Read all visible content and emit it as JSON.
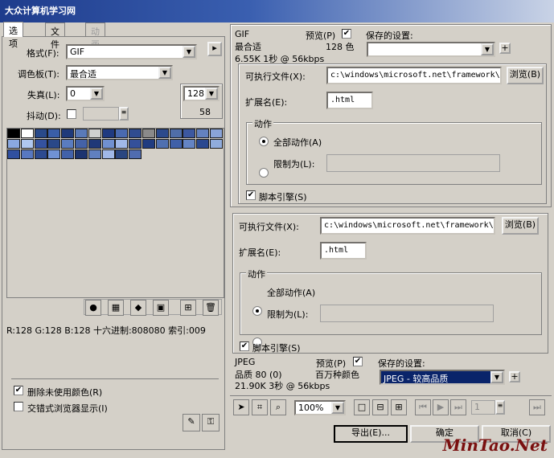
{
  "banner": {
    "logo": "大众计算机学习网"
  },
  "tabs": [
    "选项",
    "文件",
    "动画"
  ],
  "options": {
    "format_label": "格式(F):",
    "format_value": "GIF",
    "palette_label": "调色板(T):",
    "palette_value": "最合适",
    "loss_label": "失真(L):",
    "loss_value": "0",
    "dither_label": "抖动(D):",
    "colors_value": "128",
    "colors_count": "58"
  },
  "palette_info": "R:128 G:128 B:128 十六进制:808080 索引:009",
  "checks": {
    "remove_unused": "删除未使用颜色(R)",
    "interlaced": "交错式浏览器显示(I)"
  },
  "palette_colors": [
    "#000000",
    "#ffffff",
    "#2a4a8a",
    "#3a5ea8",
    "#1f3a7a",
    "#5a7ab8",
    "#d0d0d0",
    "#203a80",
    "#4a6ab0",
    "#304c90",
    "#8a8a8a",
    "#2c4a8c",
    "#506ea8",
    "#3c58a0",
    "#6482c0",
    "#8aa4d8",
    "#8aa8e0",
    "#b0c8f0",
    "#3452a0",
    "#2a4888",
    "#5a7cc0",
    "#4462a8",
    "#1f3878",
    "#7090d0",
    "#a0b8e8",
    "#34509a",
    "#203c80",
    "#5070b0",
    "#4060a8",
    "#6484c4",
    "#2a4890",
    "#90acdc",
    "#3050a0",
    "#5878c0",
    "#2c4a90",
    "#7092d4",
    "#4262aa",
    "#1c3470",
    "#6080c0",
    "#a0b8e8",
    "#2a4680",
    "#506cb0"
  ],
  "preview1": {
    "format": "GIF",
    "quality": "最合适",
    "size": "6.55K 1秒 @ 56kbps",
    "preview_label": "预览(P)",
    "colors": "128 色",
    "saved_label": "保存的设置:",
    "saved_value": ""
  },
  "dialog1": {
    "exec_label": "可执行文件(X):",
    "exec_value": "c:\\windows\\microsoft.net\\framework\\v",
    "browse": "浏览(B)",
    "ext_label": "扩展名(E):",
    "ext_value": ".html",
    "action_label": "动作",
    "all_action": "全部动作(A)",
    "limit_label": "限制为(L):",
    "script_engine": "脚本引擎(S)"
  },
  "dialog2": {
    "exec_label": "可执行文件(X):",
    "exec_value": "c:\\windows\\microsoft.net\\framework\\v",
    "browse": "浏览(B)",
    "ext_label": "扩展名(E):",
    "ext_value": ".html",
    "action_label": "动作",
    "all_action": "全部动作(A)",
    "limit_label": "限制为(L):",
    "script_engine": "脚本引擎(S)"
  },
  "preview2": {
    "format": "JPEG",
    "quality": "品质 80 (0)",
    "size": "21.90K 3秒 @ 56kbps",
    "preview_label": "预览(P)",
    "colors": "百万种颜色",
    "saved_label": "保存的设置:",
    "saved_value": "JPEG - 较高品质"
  },
  "toolbar": {
    "zoom": "100%",
    "frame": "1"
  },
  "buttons": {
    "export": "导出(E)...",
    "ok": "确定",
    "cancel": "取消(C)"
  },
  "watermark": "MinTao.Net"
}
